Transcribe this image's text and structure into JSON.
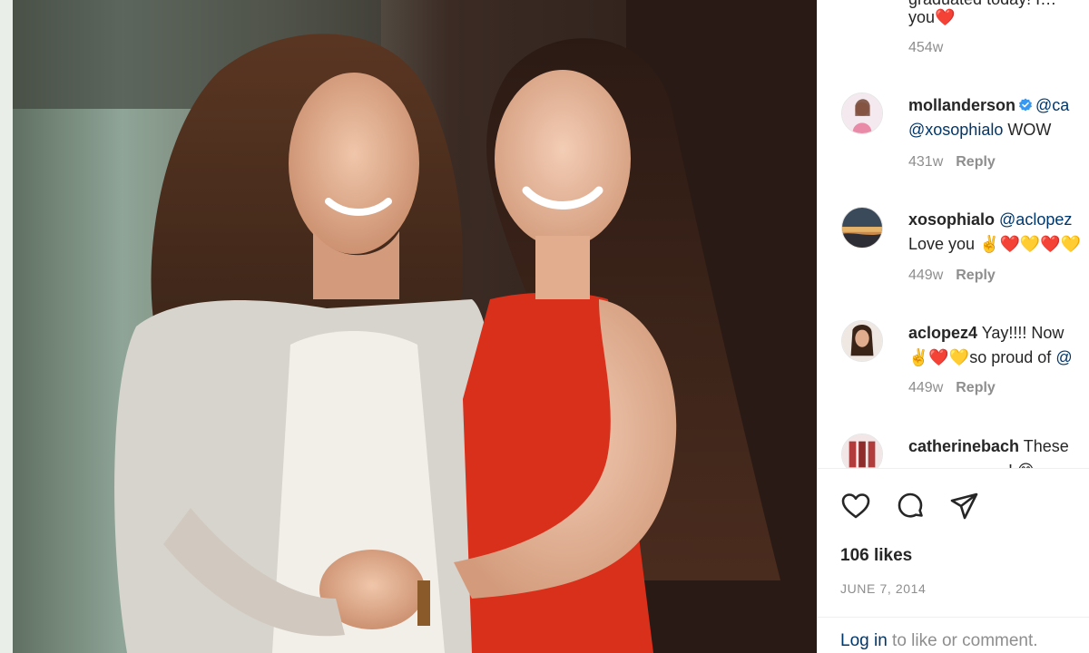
{
  "post": {
    "image_alt": "Two women smiling and holding hands",
    "likes": "106 likes",
    "date": "JUNE 7, 2014",
    "login_link": "Log in",
    "login_rest": " to like or comment."
  },
  "comments": [
    {
      "username": "",
      "line1": "graduated today! I…",
      "line2": "you❤️",
      "time": "454w",
      "reply": ""
    },
    {
      "username": "mollanderson",
      "verified": true,
      "line1_mention": "@ca",
      "line2_mention": "@xosophialo",
      "line2_text": " WOW",
      "time": "431w",
      "reply": "Reply"
    },
    {
      "username": "xosophialo",
      "line1_mention": "@aclopez",
      "line2_text": "Love you ✌️❤️💛❤️💛",
      "time": "449w",
      "reply": "Reply"
    },
    {
      "username": "aclopez4",
      "line1_text": " Yay!!!! Now",
      "line2_text": "✌️❤️💛so proud of ",
      "line2_mention": "@",
      "time": "449w",
      "reply": "Reply"
    },
    {
      "username": "catherinebach",
      "line1_text": " These",
      "line2_text": "… … … … …! 😊",
      "time": "",
      "reply": ""
    }
  ],
  "icons": {
    "like": "heart-icon",
    "comment": "comment-bubble-icon",
    "share": "paper-plane-icon",
    "verified": "verified-badge-icon"
  },
  "colors": {
    "link": "#00376b",
    "muted": "#8e8e8e",
    "verified": "#3897f0",
    "dress": "#d9301b"
  }
}
